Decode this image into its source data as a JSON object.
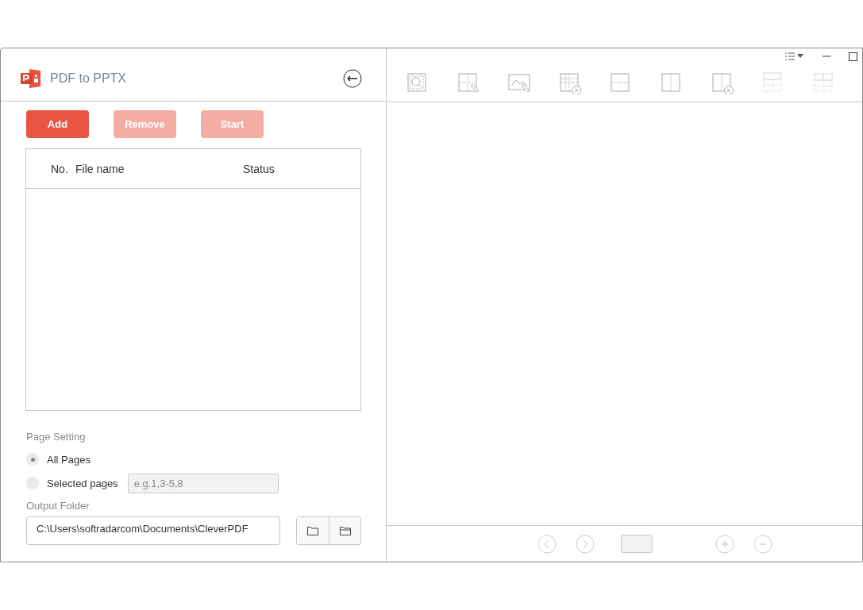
{
  "app": {
    "title": "PDF to PPTX"
  },
  "actions": [
    {
      "label": "Add",
      "disabled": false
    },
    {
      "label": "Remove",
      "disabled": true
    },
    {
      "label": "Start",
      "disabled": true
    }
  ],
  "file_table": {
    "columns": [
      "No.",
      "File name",
      "Status"
    ]
  },
  "page_setting": {
    "label": "Page Setting",
    "options": [
      {
        "label": "All Pages",
        "selected": true
      },
      {
        "label": "Selected pages",
        "selected": false
      }
    ],
    "range_field": {
      "placeholder": "e.g.1,3-5,8"
    }
  },
  "output_folder": {
    "label": "Output Folder",
    "path": "C:\\Users\\softradarcom\\Documents\\CleverPDF"
  },
  "toolbar": [
    {
      "kind": "search",
      "disabled": false
    },
    {
      "kind": "edit-grid",
      "disabled": false
    },
    {
      "kind": "edit-image",
      "disabled": false
    },
    {
      "kind": "delete-grid",
      "disabled": false
    },
    {
      "kind": "hsplit",
      "disabled": false
    },
    {
      "kind": "vsplit",
      "disabled": false
    },
    {
      "kind": "delete-split",
      "disabled": false
    },
    {
      "kind": "header-row",
      "disabled": true
    },
    {
      "kind": "header-cells",
      "disabled": true
    }
  ]
}
